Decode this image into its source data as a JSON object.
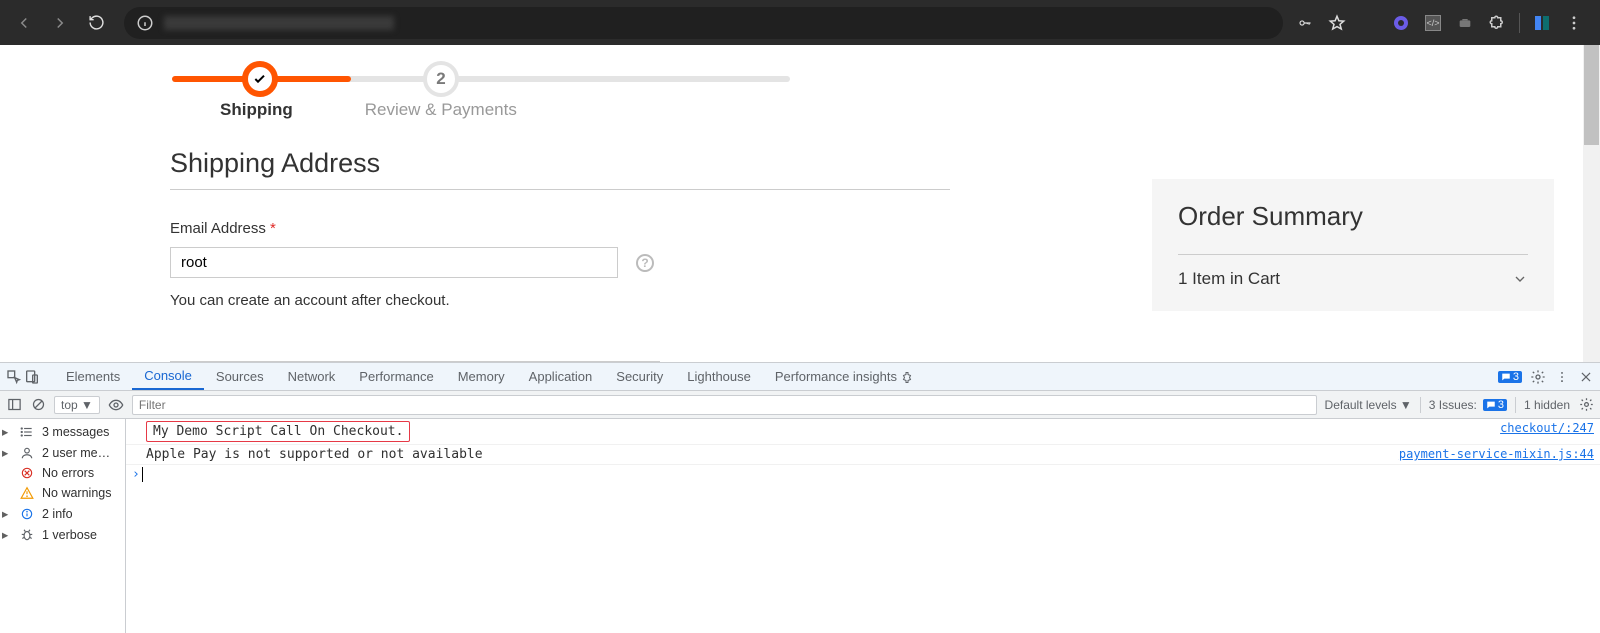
{
  "browser": {
    "address": "127.0.0.1/checkout/shipping"
  },
  "checkout": {
    "step1_label": "Shipping",
    "step2_label": "Review & Payments",
    "step2_num": "2",
    "section_title": "Shipping Address",
    "email_label": "Email Address",
    "email_value": "root",
    "hint": "You can create an account after checkout.",
    "summary_title": "Order Summary",
    "cart_line": "1 Item in Cart"
  },
  "devtools": {
    "tabs": [
      "Elements",
      "Console",
      "Sources",
      "Network",
      "Performance",
      "Memory",
      "Application",
      "Security",
      "Lighthouse",
      "Performance insights"
    ],
    "active_tab": "Console",
    "msg_count": "3",
    "filter_placeholder": "Filter",
    "context": "top",
    "levels": "Default levels",
    "issues_label": "3 Issues:",
    "issues_count": "3",
    "hidden": "1 hidden",
    "sidebar": [
      {
        "icon": "list",
        "text": "3 messages",
        "tri": true
      },
      {
        "icon": "user",
        "text": "2 user me…",
        "tri": true
      },
      {
        "icon": "errx",
        "text": "No errors",
        "tri": false
      },
      {
        "icon": "warn",
        "text": "No warnings",
        "tri": false
      },
      {
        "icon": "info",
        "text": "2 info",
        "tri": true
      },
      {
        "icon": "bug",
        "text": "1 verbose",
        "tri": true
      }
    ],
    "console": [
      {
        "msg": "My Demo Script Call On Checkout.",
        "src": "checkout/:247",
        "hi": true
      },
      {
        "msg": "Apple Pay is not supported or not available",
        "src": "payment-service-mixin.js:44",
        "hi": false
      }
    ]
  }
}
